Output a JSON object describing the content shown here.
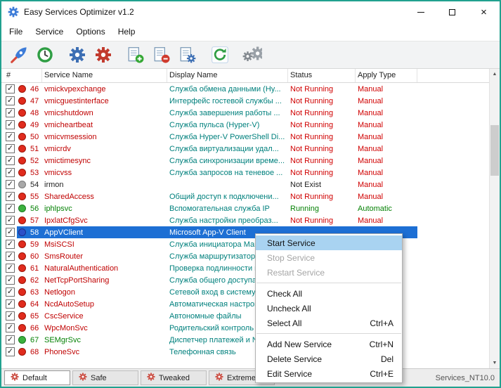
{
  "window": {
    "title": "Easy Services Optimizer v1.2"
  },
  "icons": {
    "check": "✓",
    "close": "×",
    "scroll_up": "▲",
    "scroll_down": "▼"
  },
  "menu_bar": {
    "items": [
      "File",
      "Service",
      "Options",
      "Help"
    ]
  },
  "toolbar": {
    "buttons": [
      "optimize-rocket-icon",
      "restore-defaults-clock-icon",
      "install-service-gear-icon",
      "uninstall-service-gear-icon",
      "add-service-icon",
      "delete-service-icon",
      "edit-service-icon",
      "refresh-icon",
      "options-gears-icon"
    ]
  },
  "table": {
    "columns": [
      "#",
      "Service Name",
      "Display Name",
      "Status",
      "Apply Type"
    ],
    "rows": [
      {
        "num": "46",
        "checked": true,
        "dot": "red",
        "service": "vmickvpexchange",
        "display": "Служба обмена данными (Hy...",
        "status": "Not Running",
        "apply": "Manual"
      },
      {
        "num": "47",
        "checked": true,
        "dot": "red",
        "service": "vmicguestinterface",
        "display": "Интерфейс гостевой службы ...",
        "status": "Not Running",
        "apply": "Manual"
      },
      {
        "num": "48",
        "checked": true,
        "dot": "red",
        "service": "vmicshutdown",
        "display": "Служба завершения работы ...",
        "status": "Not Running",
        "apply": "Manual"
      },
      {
        "num": "49",
        "checked": true,
        "dot": "red",
        "service": "vmicheartbeat",
        "display": "Служба пульса (Hyper-V)",
        "status": "Not Running",
        "apply": "Manual"
      },
      {
        "num": "50",
        "checked": true,
        "dot": "red",
        "service": "vmicvmsession",
        "display": "Служба Hyper-V PowerShell Di...",
        "status": "Not Running",
        "apply": "Manual"
      },
      {
        "num": "51",
        "checked": true,
        "dot": "red",
        "service": "vmicrdv",
        "display": "Служба виртуализации удал...",
        "status": "Not Running",
        "apply": "Manual"
      },
      {
        "num": "52",
        "checked": true,
        "dot": "red",
        "service": "vmictimesync",
        "display": "Служба синхронизации време...",
        "status": "Not Running",
        "apply": "Manual"
      },
      {
        "num": "53",
        "checked": true,
        "dot": "red",
        "service": "vmicvss",
        "display": "Служба запросов на теневое ...",
        "status": "Not Running",
        "apply": "Manual"
      },
      {
        "num": "54",
        "checked": true,
        "dot": "gray",
        "service": "irmon",
        "display": "",
        "status": "Not Exist",
        "apply": "Manual"
      },
      {
        "num": "55",
        "checked": true,
        "dot": "red",
        "service": "SharedAccess",
        "display": "Общий доступ к подключени...",
        "status": "Not Running",
        "apply": "Manual"
      },
      {
        "num": "56",
        "checked": true,
        "dot": "green",
        "service": "iphlpsvc",
        "display": "Вспомогательная служба IP",
        "status": "Running",
        "apply": "Automatic"
      },
      {
        "num": "57",
        "checked": true,
        "dot": "red",
        "service": "IpxlatCfgSvc",
        "display": "Служба настройки преобраз...",
        "status": "Not Running",
        "apply": "Manual"
      },
      {
        "num": "58",
        "checked": true,
        "dot": "blue",
        "service": "AppVClient",
        "display": "Microsoft App-V Client",
        "status": "",
        "apply": ""
      },
      {
        "num": "59",
        "checked": true,
        "dot": "red",
        "service": "MsiSCSI",
        "display": "Служба инициатора Майкрос...",
        "status": "",
        "apply": ""
      },
      {
        "num": "60",
        "checked": true,
        "dot": "red",
        "service": "SmsRouter",
        "display": "Служба маршрутизатора SM...",
        "status": "",
        "apply": ""
      },
      {
        "num": "61",
        "checked": true,
        "dot": "red",
        "service": "NaturalAuthentication",
        "display": "Проверка подлинности на о...",
        "status": "",
        "apply": ""
      },
      {
        "num": "62",
        "checked": true,
        "dot": "red",
        "service": "NetTcpPortSharing",
        "display": "Служба общего доступа к по...",
        "status": "",
        "apply": ""
      },
      {
        "num": "63",
        "checked": true,
        "dot": "red",
        "service": "Netlogon",
        "display": "Сетевой вход в систему",
        "status": "",
        "apply": ""
      },
      {
        "num": "64",
        "checked": true,
        "dot": "red",
        "service": "NcdAutoSetup",
        "display": "Автоматическая настройка ...",
        "status": "",
        "apply": ""
      },
      {
        "num": "65",
        "checked": true,
        "dot": "red",
        "service": "CscService",
        "display": "Автономные файлы",
        "status": "",
        "apply": ""
      },
      {
        "num": "66",
        "checked": true,
        "dot": "red",
        "service": "WpcMonSvc",
        "display": "Родительский контроль",
        "status": "",
        "apply": ""
      },
      {
        "num": "67",
        "checked": true,
        "dot": "green",
        "service": "SEMgrSvc",
        "display": "Диспетчер платежей и NFC/...",
        "status": "",
        "apply": ""
      },
      {
        "num": "68",
        "checked": true,
        "dot": "red",
        "service": "PhoneSvc",
        "display": "Телефонная связь",
        "status": "",
        "apply": ""
      }
    ]
  },
  "context_menu": {
    "items": [
      {
        "label": "Start Service",
        "state": "highlighted"
      },
      {
        "label": "Stop Service",
        "state": "disabled"
      },
      {
        "label": "Restart Service",
        "state": "disabled"
      },
      {
        "type": "separator"
      },
      {
        "label": "Check All",
        "state": "normal"
      },
      {
        "label": "Uncheck All",
        "state": "normal"
      },
      {
        "label": "Select All",
        "shortcut": "Ctrl+A",
        "state": "normal"
      },
      {
        "type": "separator"
      },
      {
        "label": "Add New Service",
        "shortcut": "Ctrl+N",
        "state": "normal"
      },
      {
        "label": "Delete Service",
        "shortcut": "Del",
        "state": "normal"
      },
      {
        "label": "Edit Service",
        "shortcut": "Ctrl+E",
        "state": "normal"
      }
    ]
  },
  "tabs": [
    {
      "label": "Default",
      "active": true
    },
    {
      "label": "Safe",
      "active": false
    },
    {
      "label": "Tweaked",
      "active": false
    },
    {
      "label": "Extreme",
      "active": false
    }
  ],
  "status_bar": {
    "text": "Services_NT10.0"
  },
  "colors": {
    "accent_teal": "#21a18f",
    "selection_blue": "#1d6fd4",
    "stopped_red": "#c00202",
    "running_green": "#068206",
    "display_teal": "#00807d",
    "menu_highlight": "#a9d3f1"
  }
}
